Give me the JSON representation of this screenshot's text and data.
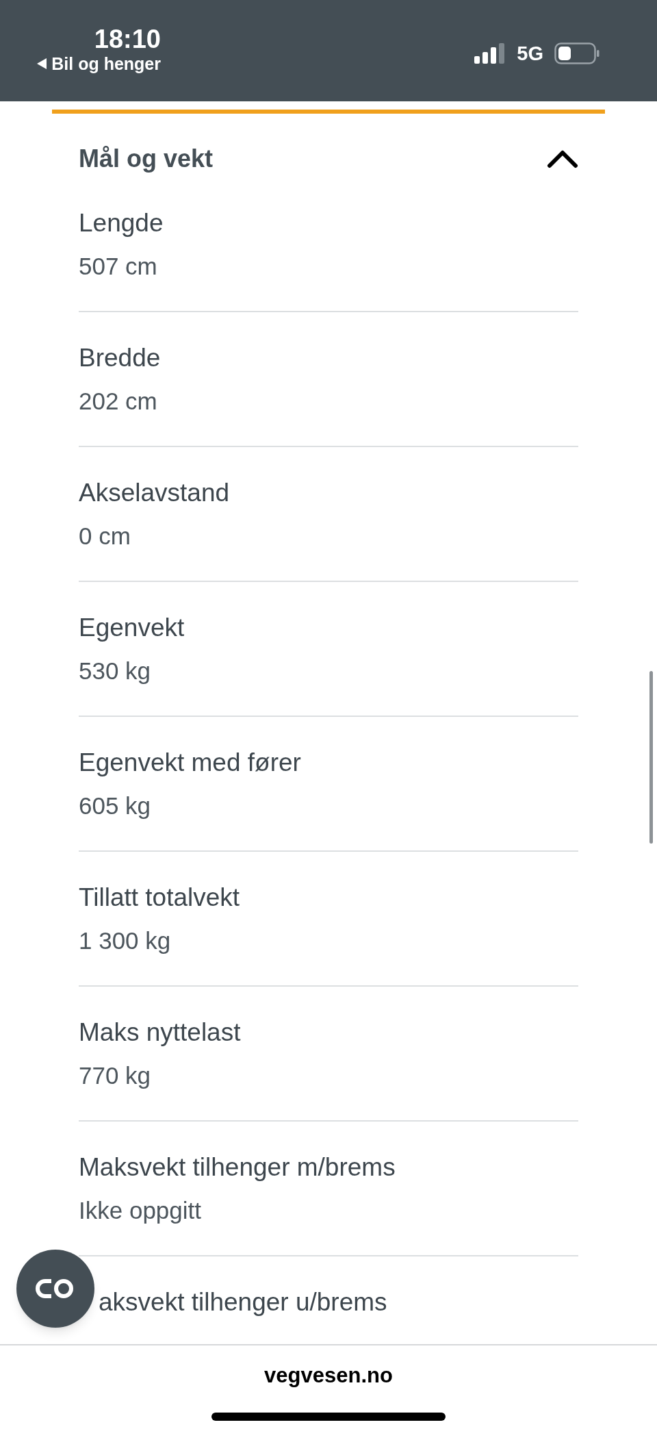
{
  "status_bar": {
    "time": "18:10",
    "back_label": "Bil og henger",
    "network": "5G"
  },
  "section": {
    "title": "Mål og vekt",
    "expanded": true,
    "rows": [
      {
        "label": "Lengde",
        "value": "507 cm"
      },
      {
        "label": "Bredde",
        "value": "202 cm"
      },
      {
        "label": "Akselavstand",
        "value": "0 cm"
      },
      {
        "label": "Egenvekt",
        "value": "530 kg"
      },
      {
        "label": "Egenvekt med fører",
        "value": "605 kg"
      },
      {
        "label": "Tillatt totalvekt",
        "value": "1 300 kg"
      },
      {
        "label": "Maks nyttelast",
        "value": "770 kg"
      },
      {
        "label": "Maksvekt tilhenger m/brems",
        "value": "Ikke oppgitt"
      },
      {
        "label": "aksvekt tilhenger u/brems",
        "covered_start": true
      }
    ]
  },
  "address_bar": {
    "url": "vegvesen.no"
  }
}
